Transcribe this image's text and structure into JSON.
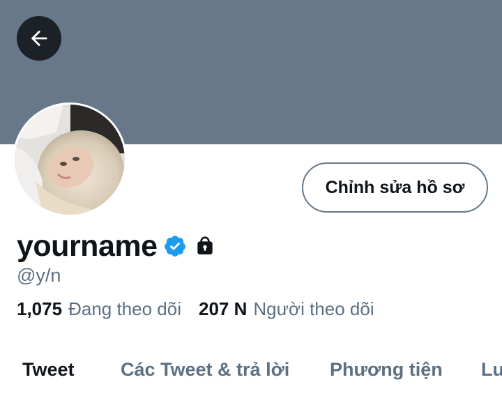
{
  "header": {
    "back_icon": "arrow-left-icon",
    "banner_color": "#66788a"
  },
  "profile": {
    "avatar_icon": "profile-photo",
    "edit_button_label": "Chỉnh sửa hồ sơ",
    "display_name": "yourname",
    "verified_icon": "verified-badge-icon",
    "verified_color": "#1d9bf0",
    "lock_icon": "lock-icon",
    "handle": "@y/n",
    "following_count": "1,075",
    "following_label": "Đang theo dõi",
    "followers_count": "207 N",
    "followers_label": "Người theo dõi"
  },
  "tabs": [
    {
      "label": "Tweet",
      "active": true
    },
    {
      "label": "Các Tweet & trả lời",
      "active": false
    },
    {
      "label": "Phương tiện",
      "active": false
    },
    {
      "label": "Lượt thích",
      "active": false
    }
  ]
}
